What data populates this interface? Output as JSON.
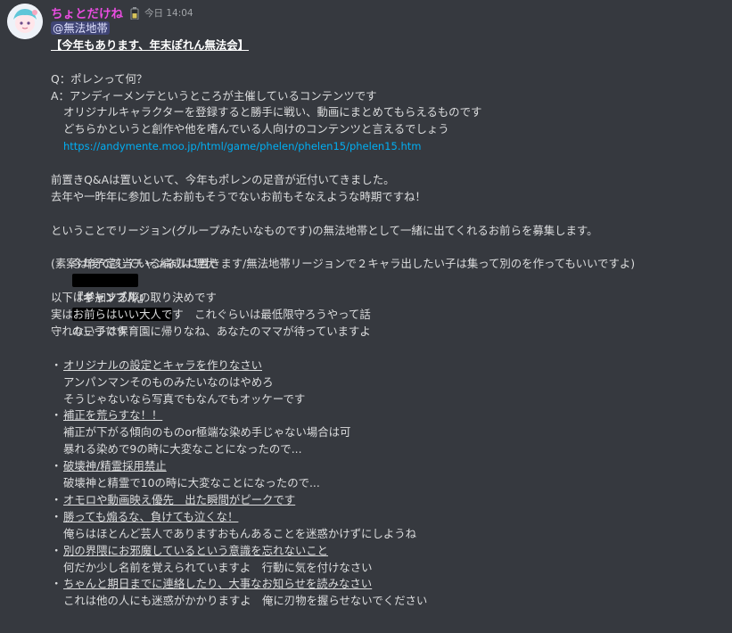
{
  "message": {
    "username": "ちょとだけね",
    "role_icon": "battery-icon",
    "timestamp": "今日 14:04",
    "mention": "@無法地帯",
    "title": "【今年もあります、年末ぽれん無法会】",
    "q_line": "Q：ポレンって何？",
    "a_line": "A：アンディーメンテというところが主催しているコンテンツです",
    "a_line2": "オリジナルキャラクターを登録すると勝手に戦い、動画にまとめてもらえるものです",
    "a_line3": "どちらかというと創作や他を嗜んでいる人向けのコンテンツと言えるでしょう",
    "link": "https://andymente.moo.jp/html/game/phelen/phelen15/phelen15.htm",
    "p1_line1": "前置きQ&Aは置いといて、今年もポレンの足音が近付いてきました。",
    "p1_line2": "去年や一昨年に参加したお前もそうでないお前もそなえような時期ですね！",
    "p2_line1": "ということでリージョン(グループみたいなものです)の無法地帯として一緒に出てくれるお前らを募集します。",
    "p2_line2_a": "今年予定している編成は現状",
    "p2_line2_b": "『ギャンブル』",
    "p2_line2_c": "の三つです",
    "p2_line3": "(素案は後で該当チャンネルに置きます/無法地帯リージョンで２キャラ出したい子は集って別のを作ってもいいですよ)",
    "p3_line1": "以下は参加する際の取り決めです",
    "p3_line2": "実はお前らはいい大人です　これぐらいは最低限守ろうやって話",
    "p3_line3": "守れない子は保育園に帰りなね、あなたのママが待っていますよ",
    "bullet": "・",
    "rules": [
      {
        "heading": "オリジナルの設定とキャラを作りなさい",
        "details": [
          "アンパンマンそのものみたいなのはやめろ",
          "そうじゃないなら写真でもなんでもオッケーです"
        ]
      },
      {
        "heading": "補正を荒らすな！！",
        "details": [
          "補正が下がる傾向のものor極端な染め手じゃない場合は可",
          "暴れる染めで9の時に大変なことになったので..."
        ]
      },
      {
        "heading": "破壊神/精霊採用禁止",
        "details": [
          "破壊神と精霊で10の時に大変なことになったので..."
        ]
      },
      {
        "heading": "オモロや動画映え優先　出た瞬間がピークです",
        "details": []
      },
      {
        "heading": "勝っても煽るな、負けても泣くな！",
        "details": [
          "俺らはほとんど芸人でありますおもんあることを迷惑かけずにしようね"
        ]
      },
      {
        "heading": "別の界隈にお邪魔しているという意識を忘れないこと",
        "details": [
          "何だか少し名前を覚えられていますよ　行動に気を付けなさい"
        ]
      },
      {
        "heading": "ちゃんと期日までに連絡したり、大事なお知らせを読みなさい",
        "details": [
          "これは他の人にも迷惑がかかりますよ　俺に刃物を握らせないでください"
        ]
      }
    ]
  },
  "colors": {
    "background": "#36393f",
    "text": "#dcddde",
    "username": "#e94de0",
    "link": "#00aff4",
    "mention_bg": "#5865f2"
  }
}
